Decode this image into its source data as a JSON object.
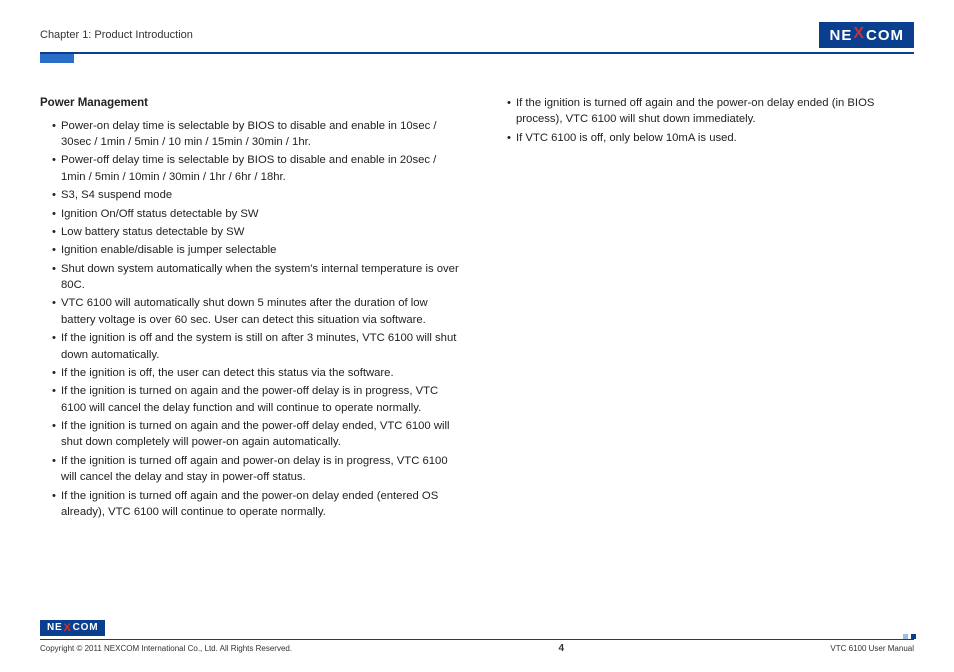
{
  "header": {
    "chapter": "Chapter 1: Product Introduction",
    "logo_text_pre": "NE",
    "logo_text_x": "X",
    "logo_text_post": "COM"
  },
  "content": {
    "section_title": "Power Management",
    "left_bullets": [
      "Power-on delay time is selectable by BIOS to disable and enable in 10sec / 30sec / 1min / 5min / 10 min / 15min / 30min / 1hr.",
      "Power-off delay time is selectable by BIOS to disable and enable in 20sec / 1min / 5min / 10min / 30min / 1hr / 6hr / 18hr.",
      "S3, S4 suspend mode",
      "Ignition On/Off status detectable by SW",
      "Low battery status detectable by SW",
      "Ignition enable/disable is jumper selectable",
      "Shut down system automatically when the system's internal temperature is over 80C.",
      "VTC 6100 will automatically shut down 5 minutes after the duration of low battery voltage is over 60 sec. User can detect this situation via software.",
      "If the ignition is off and the system is still on after 3 minutes, VTC 6100 will shut down automatically.",
      "If the ignition is off, the user can detect this status via the software.",
      "If the ignition is turned on again and the power-off delay is in progress, VTC 6100 will cancel the delay function and will continue to operate normally.",
      "If the ignition is turned on again and the power-off delay ended, VTC 6100 will shut down completely will power-on again automatically.",
      "If the ignition is turned off again and power-on delay is in progress, VTC 6100 will cancel the delay and stay in power-off status.",
      "If the ignition is turned off again and the power-on delay ended (entered OS already), VTC 6100 will continue to operate normally."
    ],
    "right_bullets": [
      "If the ignition is turned off again and the power-on delay ended (in BIOS process), VTC 6100 will shut down immediately.",
      "If VTC 6100 is off, only below 10mA is used."
    ]
  },
  "footer": {
    "copyright": "Copyright © 2011 NEXCOM International Co., Ltd. All Rights Reserved.",
    "page_number": "4",
    "doc_title": "VTC 6100 User Manual"
  }
}
